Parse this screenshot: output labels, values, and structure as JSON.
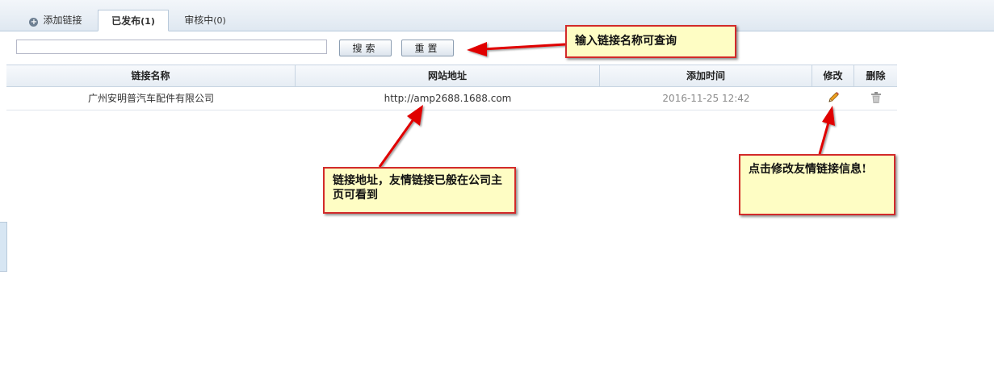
{
  "tabs": {
    "add_label": "添加链接",
    "published_label": "已发布",
    "published_count": "(1)",
    "review_label": "审核中",
    "review_count": "(0)"
  },
  "search": {
    "value": "",
    "search_button": "搜索",
    "reset_button": "重置"
  },
  "table": {
    "columns": [
      "链接名称",
      "网站地址",
      "添加时间",
      "修改",
      "删除"
    ],
    "rows": [
      {
        "name": "广州安明普汽车配件有限公司",
        "url": "http://amp2688.1688.com",
        "time": "2016-11-25 12:42"
      }
    ]
  },
  "annotations": {
    "search_tip": "输入链接名称可查询",
    "url_tip": "链接地址，友情链接已般在公司主页可看到",
    "edit_tip": "点击修改友情链接信息!"
  },
  "colors": {
    "annotation_border": "#d22a2a",
    "annotation_bg": "#fefdc4",
    "header_border": "#c7d4e2"
  },
  "icons": {
    "edit": "pencil-icon",
    "delete": "trash-icon",
    "add": "plus-circle-icon"
  }
}
